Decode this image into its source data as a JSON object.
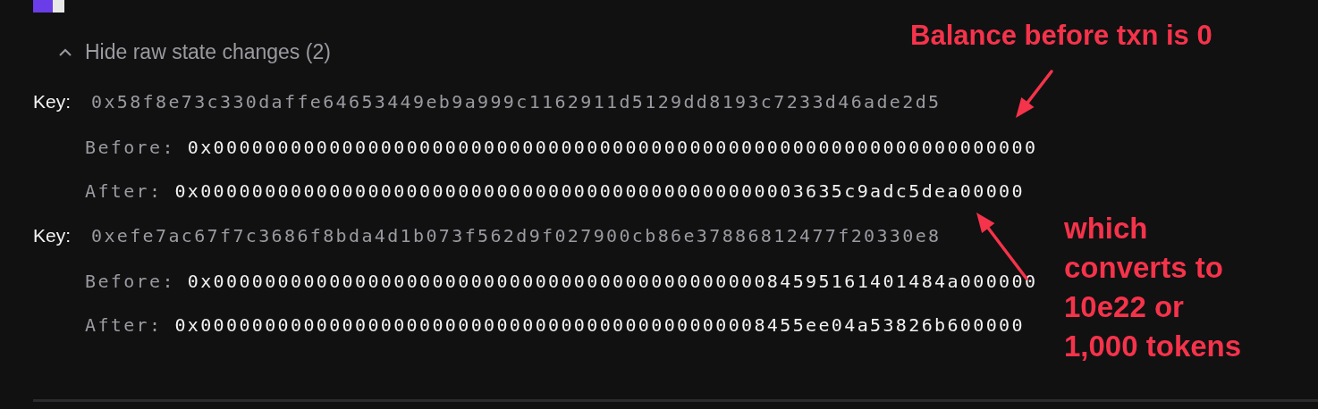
{
  "toggle": {
    "label": "Hide raw state changes (2)",
    "expanded": true
  },
  "changes": [
    {
      "key_label": "Key:",
      "key": "0x58f8e73c330daffe64653449eb9a999c1162911d5129dd8193c7233d46ade2d5",
      "before_label": "Before:",
      "before": "0x0000000000000000000000000000000000000000000000000000000000000000",
      "after_label": "After:",
      "after": "0x00000000000000000000000000000000000000000000003635c9adc5dea00000"
    },
    {
      "key_label": "Key:",
      "key": "0xefe7ac67f7c3686f8bda4d1b073f562d9f027900cb86e37886812477f20330e8",
      "before_label": "Before:",
      "before": "0x000000000000000000000000000000000000000000084595161401484a000000",
      "after_label": "After:",
      "after": "0x00000000000000000000000000000000000000000008455ee04a53826b600000"
    }
  ],
  "annotations": [
    {
      "kind": "top",
      "lines": [
        "Balance before txn is 0"
      ]
    },
    {
      "kind": "side",
      "lines": [
        "which",
        "converts to",
        "10e22 or",
        "1,000 tokens"
      ]
    }
  ]
}
